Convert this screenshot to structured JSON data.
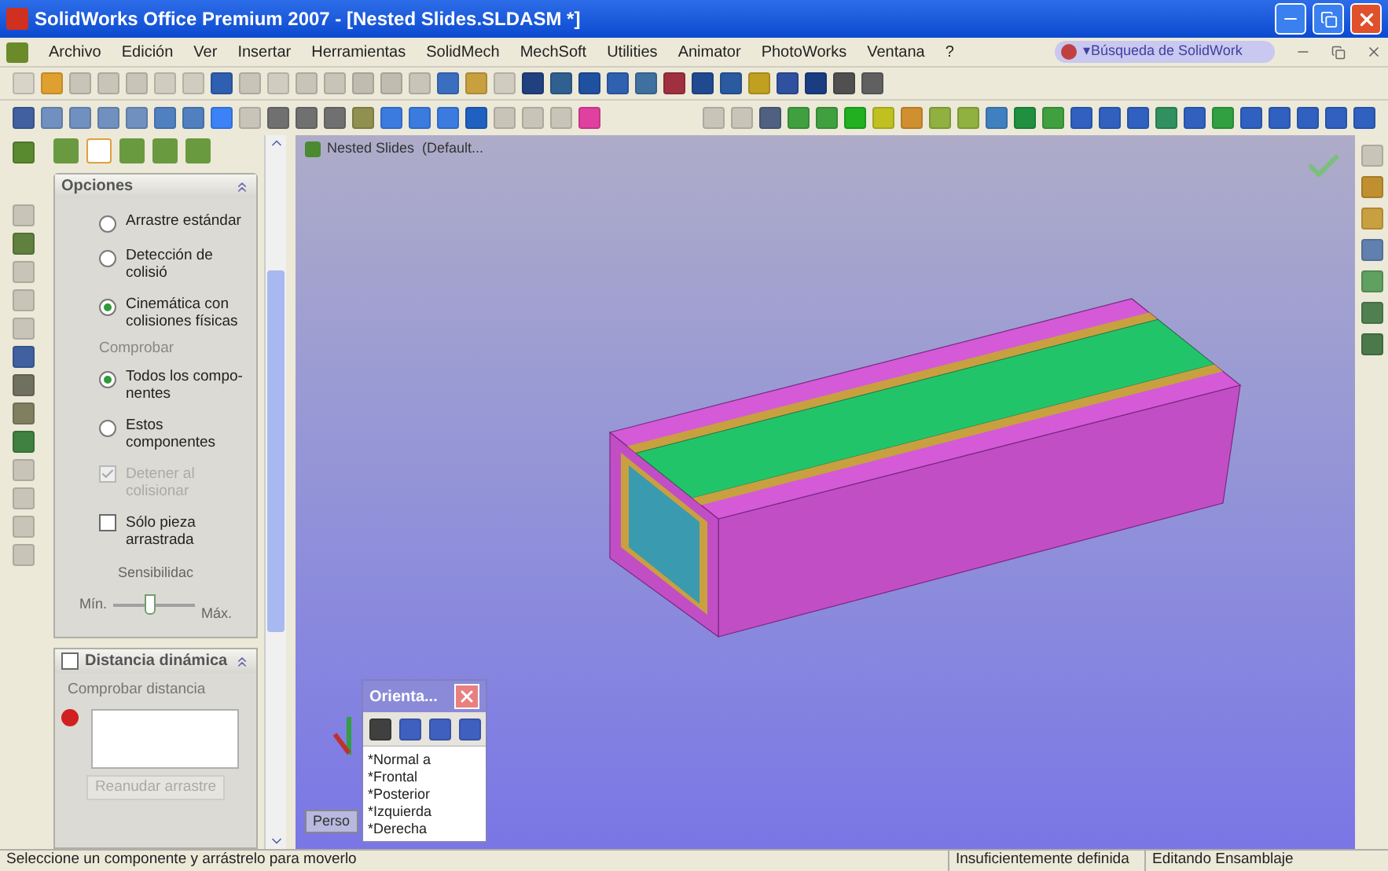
{
  "window": {
    "title": "SolidWorks Office Premium 2007 - [Nested Slides.SLDASM *]"
  },
  "menu": [
    "Archivo",
    "Edición",
    "Ver",
    "Insertar",
    "Herramientas",
    "SolidMech",
    "MechSoft",
    "Utilities",
    "Animator",
    "PhotoWorks",
    "Ventana",
    "?"
  ],
  "search": {
    "placeholder": "▾Búsqueda de SolidWork"
  },
  "panel": {
    "tabs": [
      {
        "selected": false
      },
      {
        "selected": true
      },
      {
        "selected": false
      },
      {
        "selected": false
      },
      {
        "selected": false
      }
    ],
    "options_title": "Opciones",
    "mode_options": [
      {
        "label": "Arrastre estándar",
        "selected": false
      },
      {
        "label": "Detección de colisió",
        "selected": false
      },
      {
        "label": "Cinemática con colisiones físicas",
        "selected": true
      }
    ],
    "check_label": "Comprobar",
    "check_options": [
      {
        "label": "Todos los compo-nentes",
        "selected": true
      },
      {
        "label": "Estos componentes",
        "selected": false
      }
    ],
    "checkboxes": [
      {
        "label": "Detener al colisionar",
        "checked": true,
        "disabled": true
      },
      {
        "label": "Sólo pieza arrastrada",
        "checked": false,
        "disabled": false
      }
    ],
    "slider": {
      "label": "Sensibilidac",
      "min": "Mín.",
      "max": "Máx.",
      "level": 0.45
    },
    "distance": {
      "title": "Distancia dinámica",
      "checked": false,
      "label": "Comprobar distancia",
      "button": "Reanudar arrastre"
    }
  },
  "tree": {
    "label": "Nested Slides  (Default..."
  },
  "orientation": {
    "title": "Orienta...",
    "items": [
      "*Normal a",
      "*Frontal",
      "*Posterior",
      "*Izquierda",
      "*Derecha"
    ]
  },
  "bottom_tabs": [
    "Perso"
  ],
  "status_bar": {
    "message": "Seleccione un componente y arrástrelo para moverlo",
    "state": "Insuficientemente definida",
    "mode": "Editando Ensamblaje"
  }
}
